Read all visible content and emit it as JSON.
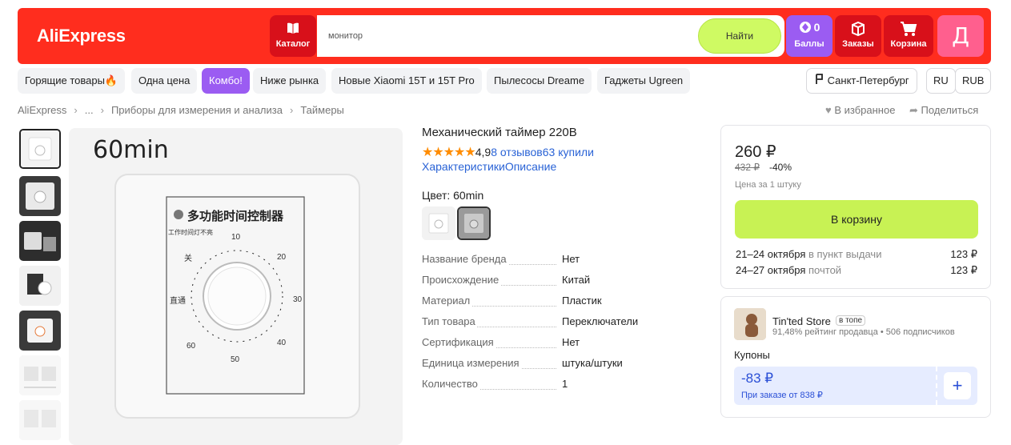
{
  "header": {
    "logo": "AliExpress",
    "catalog_label": "Каталог",
    "search_placeholder": "монитор",
    "search_button": "Найти",
    "points_label": "Баллы",
    "points_count": "0",
    "orders_label": "Заказы",
    "cart_label": "Корзина",
    "avatar_letter": "Д",
    "colors": {
      "bar": "#ff2d1e",
      "points": "#9b5cf2",
      "avatar": "#ff5f8e",
      "search_button": "#cffa63"
    }
  },
  "chips": [
    {
      "label": "Горящие товары🔥"
    },
    {
      "label": "Одна цена"
    },
    {
      "label": "Комбо!"
    },
    {
      "label": "Ниже рынка"
    },
    {
      "label": "Новые Xiaomi 15T и 15T Pro"
    },
    {
      "label": "Пылесосы Dreame"
    },
    {
      "label": "Гаджеты Ugreen"
    }
  ],
  "locale": {
    "city": "Санкт-Петербург",
    "language": "RU",
    "currency": "RUB"
  },
  "breadcrumb": [
    "AliExpress",
    "...",
    "Приборы для измерения и анализа",
    "Таймеры"
  ],
  "actions": {
    "favorite": "В избранное",
    "share": "Поделиться"
  },
  "gallery": {
    "main_caption": "60min",
    "panel_title": "多功能时间控制器",
    "panel_subtitle": "工作时间灯不亮",
    "dial_off": "关",
    "dial_on": "直通",
    "dial_numbers": [
      "10",
      "20",
      "30",
      "40",
      "50",
      "60"
    ]
  },
  "product": {
    "title": "Механический таймер 220В",
    "stars": "★★★★★",
    "rating": "4,9",
    "reviews": "8 отзывов",
    "sold": "63 купили",
    "tab_specs": "Характеристики",
    "tab_description": "Описание",
    "color_label": "Цвет: 60min",
    "specs": [
      {
        "key": "Название бренда",
        "value": "Нет"
      },
      {
        "key": "Происхождение",
        "value": "Китай"
      },
      {
        "key": "Материал",
        "value": "Пластик"
      },
      {
        "key": "Тип товара",
        "value": "Переключатели"
      },
      {
        "key": "Сертификация",
        "value": "Нет"
      },
      {
        "key": "Единица измерения",
        "value": "штука/штуки"
      },
      {
        "key": "Количество",
        "value": "1"
      }
    ]
  },
  "buy": {
    "price": "260 ₽",
    "old_price": "432 ₽",
    "discount": "-40%",
    "per_unit": "Цена за 1 штуку",
    "cart_button": "В корзину",
    "delivery": [
      {
        "date": "21–24 октября",
        "method": "в пункт выдачи",
        "price": "123 ₽"
      },
      {
        "date": "24–27 октября",
        "method": "почтой",
        "price": "123 ₽"
      }
    ]
  },
  "seller": {
    "name": "Tin'ted Store",
    "badge": "в топе",
    "stats": "91,48% рейтинг продавца • 506 подписчиков",
    "coupons_title": "Купоны",
    "coupon_value": "-83 ₽",
    "coupon_condition": "При заказе от 838 ₽",
    "coupon_add": "+"
  }
}
